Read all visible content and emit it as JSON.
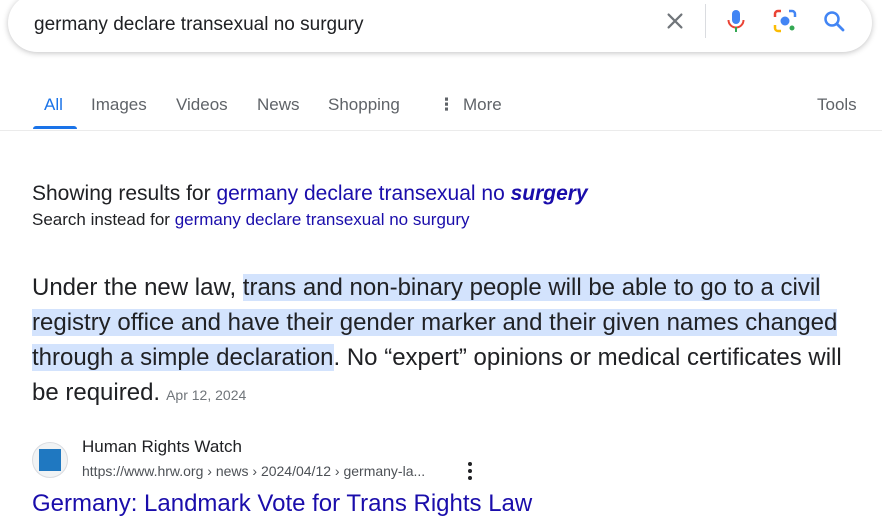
{
  "search": {
    "query": "germany declare transexual no surgury"
  },
  "tabs": {
    "items": [
      {
        "label": "All"
      },
      {
        "label": "Images"
      },
      {
        "label": "Videos"
      },
      {
        "label": "News"
      },
      {
        "label": "Shopping"
      },
      {
        "label": "More"
      }
    ],
    "tools_label": "Tools"
  },
  "correction": {
    "showing_prefix": "Showing results for",
    "corrected_query": "germany declare transexual no",
    "corrected_word": "surgery",
    "instead_prefix": "Search instead for",
    "original_query": "germany declare transexual no surgury"
  },
  "snippet": {
    "before": "Under the new law, ",
    "highlight": "trans and non-binary people will be able to go to a civil registry office and have their gender marker and their given names changed through a simple declaration",
    "after": ". No “expert” opinions or medical certificates will be required.",
    "date": "Apr 12, 2024"
  },
  "result": {
    "site_name": "Human Rights Watch",
    "url": "https://www.hrw.org › news › 2024/04/12 › germany-la...",
    "title": "Germany: Landmark Vote for Trans Rights Law"
  },
  "colors": {
    "accent": "#1a73e8",
    "link": "#1a0dab",
    "highlight": "#d3e3fd",
    "favicon": "#1f78c1"
  }
}
